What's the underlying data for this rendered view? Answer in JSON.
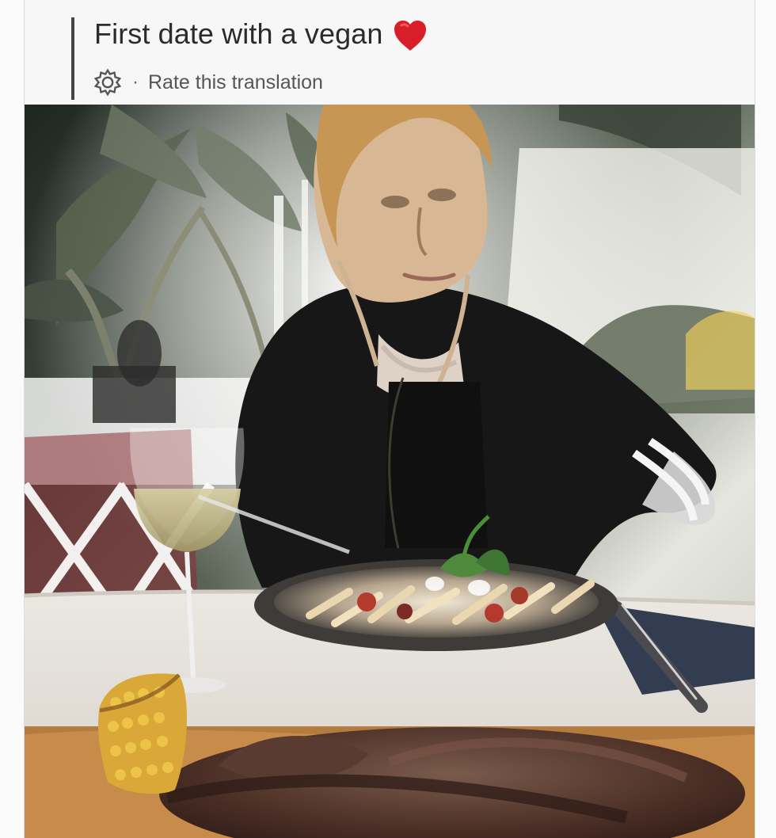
{
  "post": {
    "title": "First date with a vegan",
    "emoji": "heart-icon",
    "translation_prompt": "Rate this translation",
    "separator": "·"
  },
  "icons": {
    "translation_settings": "gear-icon"
  },
  "colors": {
    "heart": "#d81e28",
    "text": "#2b2b2b",
    "secondary_text": "#555555"
  }
}
